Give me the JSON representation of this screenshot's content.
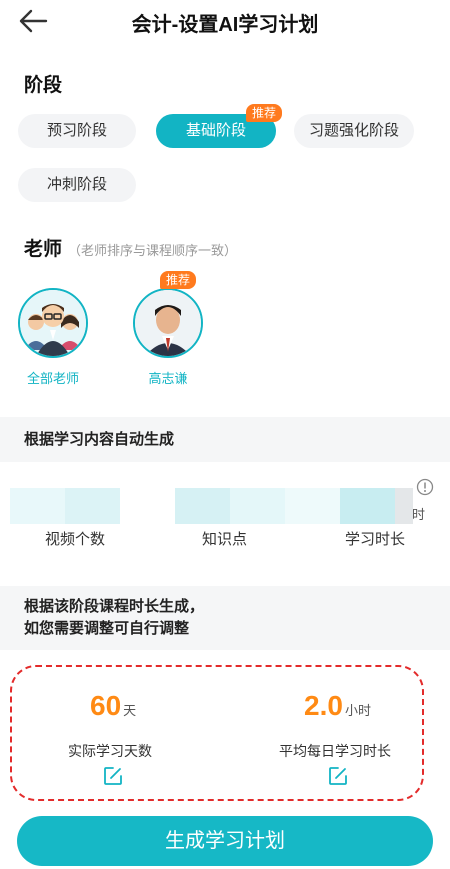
{
  "header": {
    "title": "会计-设置AI学习计划",
    "back_icon": "arrow-left-icon"
  },
  "stage": {
    "title": "阶段",
    "options": [
      {
        "label": "预习阶段",
        "active": false
      },
      {
        "label": "基础阶段",
        "active": true,
        "badge": "推荐"
      },
      {
        "label": "习题强化阶段",
        "active": false
      },
      {
        "label": "冲刺阶段",
        "active": false
      }
    ]
  },
  "teacher": {
    "title": "老师",
    "subtitle": "（老师排序与课程顺序一致）",
    "items": [
      {
        "name": "全部老师"
      },
      {
        "name": "高志谦",
        "badge": "推荐"
      }
    ]
  },
  "auto_section": {
    "title": "根据学习内容自动生成",
    "stats": [
      {
        "label": "视频个数"
      },
      {
        "label": "知识点"
      },
      {
        "label": "学习时长"
      }
    ],
    "hidden_unit_fragment": "时"
  },
  "adjust_section": {
    "line1": "根据该阶段课程时长生成，",
    "line2": "如您需要调整可自行调整"
  },
  "metrics": [
    {
      "value": "60",
      "unit": "天",
      "label": "实际学习天数"
    },
    {
      "value": "2.0",
      "unit": "小时",
      "label": "平均每日学习时长"
    }
  ],
  "cta": {
    "label": "生成学习计划"
  },
  "colors": {
    "accent": "#12b4c4",
    "badge": "#ff7a1e",
    "number": "#ff8a14",
    "highlight": "#e32b2b"
  }
}
